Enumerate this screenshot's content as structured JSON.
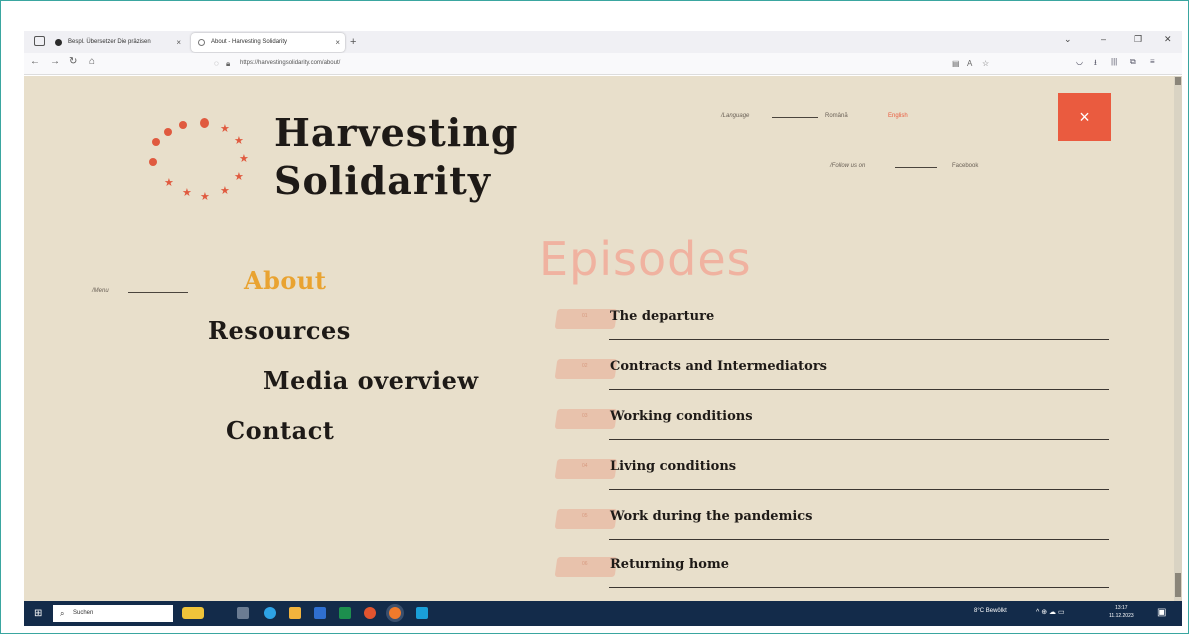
{
  "browser": {
    "tabs": [
      {
        "label": "Bespl. Übersetzer Die präzisen"
      },
      {
        "label": "About - Harvesting Solidarity"
      }
    ],
    "new_tab": "+",
    "url": "https://harvestingsolidarity.com/about/"
  },
  "site": {
    "logo_line1": "Harvesting",
    "logo_line2": "Solidarity",
    "language_label": "/Language",
    "lang_romanian": "Română",
    "lang_english": "English",
    "follow_label": "/Follow us on",
    "facebook": "Facebook",
    "close_icon": "×",
    "menu_label": "/Menu",
    "menu": [
      "About",
      "Resources",
      "Media overview",
      "Contact"
    ],
    "episodes_heading": "Episodes",
    "episodes": [
      {
        "num": "01",
        "title": "The departure"
      },
      {
        "num": "02",
        "title": "Contracts and Intermediators"
      },
      {
        "num": "03",
        "title": "Working conditions"
      },
      {
        "num": "04",
        "title": "Living conditions"
      },
      {
        "num": "05",
        "title": "Work during the pandemics"
      },
      {
        "num": "06",
        "title": "Returning home"
      }
    ]
  },
  "colors": {
    "accent": "#ea5b3f",
    "background": "#e8dfcb",
    "about_active": "#e9a331"
  },
  "taskbar": {
    "search_placeholder": "Suchen",
    "tray_text": "8°C Bewölkt",
    "time": "13:17",
    "date": "11.12.2023"
  }
}
